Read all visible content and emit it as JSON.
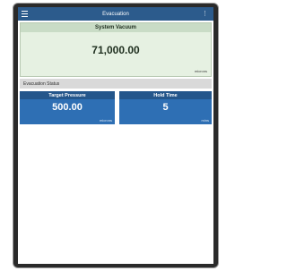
{
  "appbar": {
    "title": "Evacuation",
    "menu_icon": "hamburger-menu-icon",
    "more_icon": "kebab-menu-icon"
  },
  "vacuum": {
    "label": "System Vacuum",
    "value": "71,000.00",
    "unit": "microns"
  },
  "status": {
    "label": "Evacuation Status"
  },
  "metrics": [
    {
      "label": "Target Pressure",
      "value": "500.00",
      "unit": "microns"
    },
    {
      "label": "Hold Time",
      "value": "5",
      "unit": "mins"
    }
  ],
  "colors": {
    "appbar": "#2c5b8c",
    "vacuum_bg": "#e6f1e2",
    "vacuum_header": "#c9dcc6",
    "metric_bg": "#2e6fb4",
    "metric_header": "#24568b"
  }
}
